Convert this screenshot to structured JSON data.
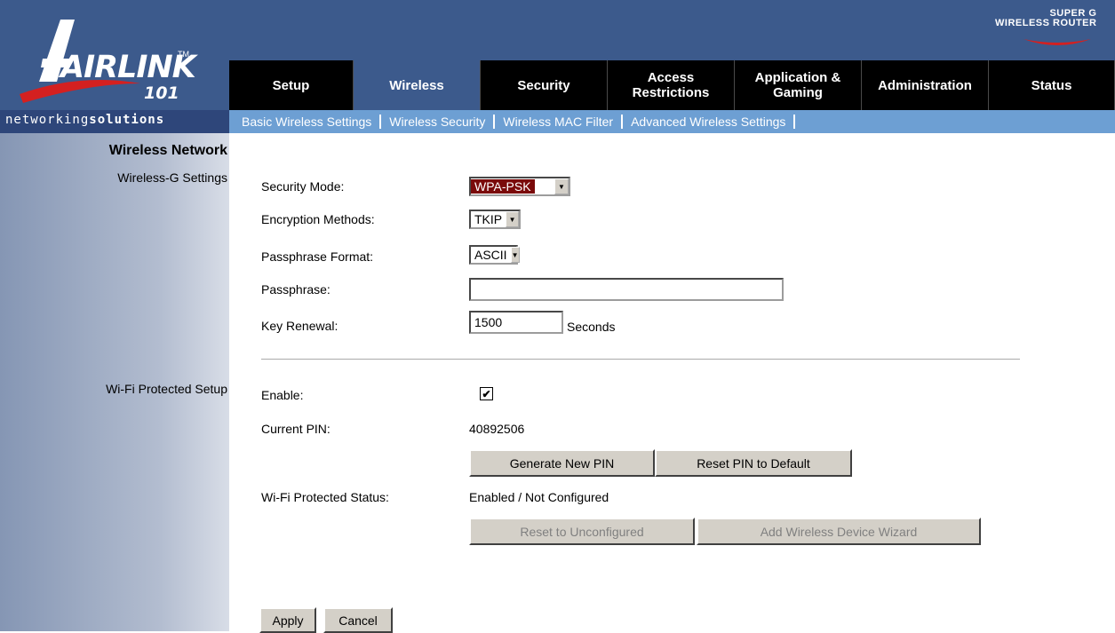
{
  "brand": {
    "logo_text": "AIRLINK",
    "logo_number": "101",
    "logo_tm": "TM",
    "tagline_a": "networking",
    "tagline_b": "solutions",
    "product_line1": "SUPER G",
    "product_line2": "WIRELESS ROUTER"
  },
  "tabs": [
    {
      "label": "Setup",
      "active": false
    },
    {
      "label": "Wireless",
      "active": true
    },
    {
      "label": "Security",
      "active": false
    },
    {
      "label": "Access Restrictions",
      "active": false
    },
    {
      "label": "Application & Gaming",
      "active": false
    },
    {
      "label": "Administration",
      "active": false
    },
    {
      "label": "Status",
      "active": false
    }
  ],
  "subnav": [
    "Basic Wireless Settings",
    "Wireless Security",
    "Wireless MAC Filter",
    "Advanced Wireless Settings"
  ],
  "sidebar": {
    "title": "Wireless Network",
    "section1": "Wireless-G Settings",
    "section2": "Wi-Fi Protected Setup"
  },
  "form": {
    "security_mode_label": "Security Mode:",
    "security_mode_value": "WPA-PSK",
    "encryption_label": "Encryption Methods:",
    "encryption_value": "TKIP",
    "passphrase_format_label": "Passphrase Format:",
    "passphrase_format_value": "ASCII",
    "passphrase_label": "Passphrase:",
    "passphrase_value": "",
    "key_renewal_label": "Key Renewal:",
    "key_renewal_value": "1500",
    "key_renewal_unit": "Seconds"
  },
  "wps": {
    "enable_label": "Enable:",
    "enable_checked": true,
    "check_mark": "✔",
    "pin_label": "Current PIN:",
    "pin_value": "40892506",
    "generate_button": "Generate New PIN",
    "reset_pin_button": "Reset PIN to Default",
    "status_label": "Wi-Fi Protected Status:",
    "status_value": "Enabled / Not Configured",
    "reset_unconfigured_button": "Reset to Unconfigured",
    "wizard_button": "Add Wireless Device Wizard"
  },
  "actions": {
    "apply": "Apply",
    "cancel": "Cancel"
  },
  "colors": {
    "header_blue": "#3c5a8c",
    "subnav_blue": "#6d9fd3",
    "tab_black": "#000000",
    "select_highlight": "#7a0a0a"
  },
  "icons": {
    "dropdown": "dropdown-arrow-icon",
    "logo_swoosh": "swoosh-icon"
  }
}
